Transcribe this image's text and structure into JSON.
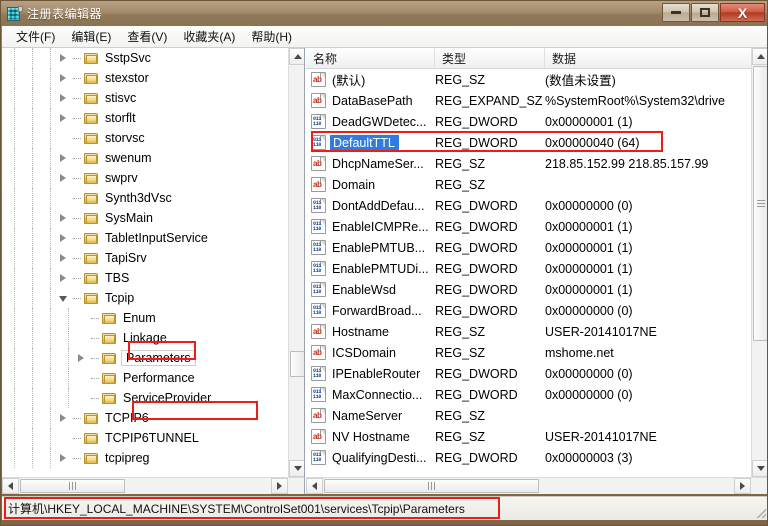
{
  "window": {
    "title": "注册表编辑器",
    "app_icon": "registry-icon",
    "buttons": {
      "minimize": "minimize-icon",
      "maximize": "maximize-icon",
      "close": "X"
    }
  },
  "menubar": {
    "items": [
      {
        "label": "文件(F)"
      },
      {
        "label": "编辑(E)"
      },
      {
        "label": "查看(V)"
      },
      {
        "label": "收藏夹(A)"
      },
      {
        "label": "帮助(H)"
      }
    ]
  },
  "tree": {
    "items": [
      {
        "label": "SstpSvc",
        "indent": 3,
        "expander": "collapsed",
        "selected": false,
        "highlight": false
      },
      {
        "label": "stexstor",
        "indent": 3,
        "expander": "collapsed",
        "selected": false,
        "highlight": false
      },
      {
        "label": "stisvc",
        "indent": 3,
        "expander": "collapsed",
        "selected": false,
        "highlight": false
      },
      {
        "label": "storflt",
        "indent": 3,
        "expander": "collapsed",
        "selected": false,
        "highlight": false
      },
      {
        "label": "storvsc",
        "indent": 3,
        "expander": "none",
        "selected": false,
        "highlight": false
      },
      {
        "label": "swenum",
        "indent": 3,
        "expander": "collapsed",
        "selected": false,
        "highlight": false
      },
      {
        "label": "swprv",
        "indent": 3,
        "expander": "collapsed",
        "selected": false,
        "highlight": false
      },
      {
        "label": "Synth3dVsc",
        "indent": 3,
        "expander": "none",
        "selected": false,
        "highlight": false
      },
      {
        "label": "SysMain",
        "indent": 3,
        "expander": "collapsed",
        "selected": false,
        "highlight": false
      },
      {
        "label": "TabletInputService",
        "indent": 3,
        "expander": "collapsed",
        "selected": false,
        "highlight": false
      },
      {
        "label": "TapiSrv",
        "indent": 3,
        "expander": "collapsed",
        "selected": false,
        "highlight": false
      },
      {
        "label": "TBS",
        "indent": 3,
        "expander": "collapsed",
        "selected": false,
        "highlight": false
      },
      {
        "label": "Tcpip",
        "indent": 3,
        "expander": "expanded",
        "selected": false,
        "highlight": true
      },
      {
        "label": "Enum",
        "indent": 4,
        "expander": "none",
        "selected": false,
        "highlight": false
      },
      {
        "label": "Linkage",
        "indent": 4,
        "expander": "none",
        "selected": false,
        "highlight": false
      },
      {
        "label": "Parameters",
        "indent": 4,
        "expander": "collapsed",
        "selected": true,
        "highlight": true
      },
      {
        "label": "Performance",
        "indent": 4,
        "expander": "none",
        "selected": false,
        "highlight": false
      },
      {
        "label": "ServiceProvider",
        "indent": 4,
        "expander": "none",
        "selected": false,
        "highlight": false
      },
      {
        "label": "TCPIP6",
        "indent": 3,
        "expander": "collapsed",
        "selected": false,
        "highlight": false
      },
      {
        "label": "TCPIP6TUNNEL",
        "indent": 3,
        "expander": "none",
        "selected": false,
        "highlight": false
      },
      {
        "label": "tcpipreg",
        "indent": 3,
        "expander": "collapsed",
        "selected": false,
        "highlight": false
      }
    ],
    "scrollbar": {
      "up": "scroll-up-icon",
      "down": "scroll-down-icon",
      "left": "scroll-left-icon",
      "right": "scroll-right-icon"
    }
  },
  "list": {
    "columns": [
      "名称",
      "类型",
      "数据"
    ],
    "rows": [
      {
        "name": "(默认)",
        "icon": "sz",
        "type": "REG_SZ",
        "data": "(数值未设置)",
        "selected": false,
        "highlight": false
      },
      {
        "name": "DataBasePath",
        "icon": "sz",
        "type": "REG_EXPAND_SZ",
        "data": "%SystemRoot%\\System32\\drive",
        "selected": false,
        "highlight": false
      },
      {
        "name": "DeadGWDetec...",
        "icon": "dword",
        "type": "REG_DWORD",
        "data": "0x00000001 (1)",
        "selected": false,
        "highlight": false
      },
      {
        "name": "DefaultTTL",
        "icon": "dword",
        "type": "REG_DWORD",
        "data": "0x00000040 (64)",
        "selected": true,
        "highlight": true
      },
      {
        "name": "DhcpNameSer...",
        "icon": "sz",
        "type": "REG_SZ",
        "data": "218.85.152.99 218.85.157.99",
        "selected": false,
        "highlight": false
      },
      {
        "name": "Domain",
        "icon": "sz",
        "type": "REG_SZ",
        "data": "",
        "selected": false,
        "highlight": false
      },
      {
        "name": "DontAddDefau...",
        "icon": "dword",
        "type": "REG_DWORD",
        "data": "0x00000000 (0)",
        "selected": false,
        "highlight": false
      },
      {
        "name": "EnableICMPRe...",
        "icon": "dword",
        "type": "REG_DWORD",
        "data": "0x00000001 (1)",
        "selected": false,
        "highlight": false
      },
      {
        "name": "EnablePMTUB...",
        "icon": "dword",
        "type": "REG_DWORD",
        "data": "0x00000001 (1)",
        "selected": false,
        "highlight": false
      },
      {
        "name": "EnablePMTUDi...",
        "icon": "dword",
        "type": "REG_DWORD",
        "data": "0x00000001 (1)",
        "selected": false,
        "highlight": false
      },
      {
        "name": "EnableWsd",
        "icon": "dword",
        "type": "REG_DWORD",
        "data": "0x00000001 (1)",
        "selected": false,
        "highlight": false
      },
      {
        "name": "ForwardBroad...",
        "icon": "dword",
        "type": "REG_DWORD",
        "data": "0x00000000 (0)",
        "selected": false,
        "highlight": false
      },
      {
        "name": "Hostname",
        "icon": "sz",
        "type": "REG_SZ",
        "data": "USER-20141017NE",
        "selected": false,
        "highlight": false
      },
      {
        "name": "ICSDomain",
        "icon": "sz",
        "type": "REG_SZ",
        "data": "mshome.net",
        "selected": false,
        "highlight": false
      },
      {
        "name": "IPEnableRouter",
        "icon": "dword",
        "type": "REG_DWORD",
        "data": "0x00000000 (0)",
        "selected": false,
        "highlight": false
      },
      {
        "name": "MaxConnectio...",
        "icon": "dword",
        "type": "REG_DWORD",
        "data": "0x00000000 (0)",
        "selected": false,
        "highlight": false
      },
      {
        "name": "NameServer",
        "icon": "sz",
        "type": "REG_SZ",
        "data": "",
        "selected": false,
        "highlight": false
      },
      {
        "name": "NV Hostname",
        "icon": "sz",
        "type": "REG_SZ",
        "data": "USER-20141017NE",
        "selected": false,
        "highlight": false
      },
      {
        "name": "QualifyingDesti...",
        "icon": "dword",
        "type": "REG_DWORD",
        "data": "0x00000003 (3)",
        "selected": false,
        "highlight": false
      }
    ]
  },
  "statusbar": {
    "path": "计算机\\HKEY_LOCAL_MACHINE\\SYSTEM\\ControlSet001\\services\\Tcpip\\Parameters"
  },
  "colors": {
    "highlight_box": "#ee1c18",
    "selection_blue": "#2f7bdf",
    "title_gradient_top": "#b7a084",
    "title_gradient_bottom": "#8a7352",
    "close_button": "#b33a24"
  }
}
